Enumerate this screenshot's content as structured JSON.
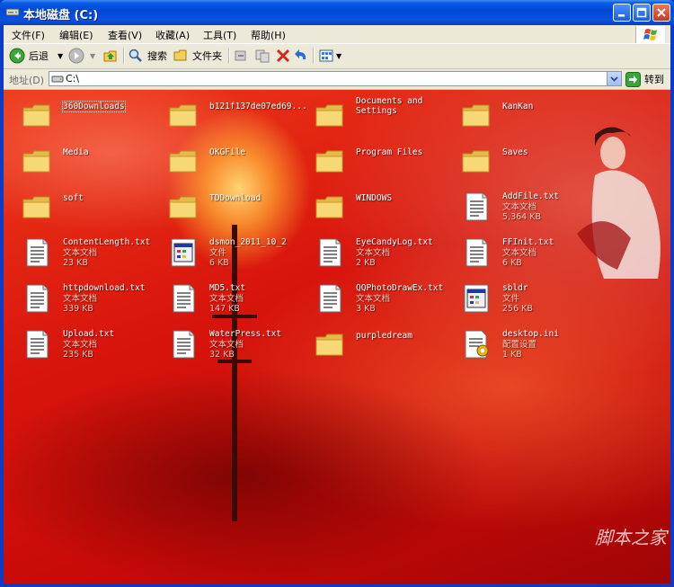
{
  "window": {
    "title": "本地磁盘 (C:)"
  },
  "menu": [
    "文件(F)",
    "编辑(E)",
    "查看(V)",
    "收藏(A)",
    "工具(T)",
    "帮助(H)"
  ],
  "toolbar": {
    "back_label": "后退",
    "search_label": "搜索",
    "folders_label": "文件夹"
  },
  "address": {
    "label": "地址(D)",
    "value": "C:\\",
    "go_label": "转到"
  },
  "watermark": "脚本之家",
  "items": [
    {
      "name": "360Downloads",
      "kind": "folder"
    },
    {
      "name": "b121f137de07ed69...",
      "kind": "folder"
    },
    {
      "name": "Documents and\nSettings",
      "kind": "folder"
    },
    {
      "name": "KanKan",
      "kind": "folder"
    },
    {
      "name": "Media",
      "kind": "folder"
    },
    {
      "name": "OKGFile",
      "kind": "folder"
    },
    {
      "name": "Program Files",
      "kind": "folder"
    },
    {
      "name": "Saves",
      "kind": "folder"
    },
    {
      "name": "soft",
      "kind": "folder"
    },
    {
      "name": "TDDownload",
      "kind": "folder"
    },
    {
      "name": "WINDOWS",
      "kind": "folder"
    },
    {
      "name": "AddFile.txt",
      "kind": "text",
      "type": "文本文档",
      "size": "5,364 KB"
    },
    {
      "name": "ContentLength.txt",
      "kind": "text",
      "type": "文本文档",
      "size": "23 KB"
    },
    {
      "name": "dsmon_2011_10_2",
      "kind": "app",
      "type": "文件",
      "size": "6 KB"
    },
    {
      "name": "EyeCandyLog.txt",
      "kind": "text",
      "type": "文本文档",
      "size": "2 KB"
    },
    {
      "name": "FFInit.txt",
      "kind": "text",
      "type": "文本文档",
      "size": "6 KB"
    },
    {
      "name": "httpdownload.txt",
      "kind": "text",
      "type": "文本文档",
      "size": "339 KB"
    },
    {
      "name": "MD5.txt",
      "kind": "text",
      "type": "文本文档",
      "size": "147 KB"
    },
    {
      "name": "QQPhotoDrawEx.txt",
      "kind": "text",
      "type": "文本文档",
      "size": "3 KB"
    },
    {
      "name": "sbldr",
      "kind": "app",
      "type": "文件",
      "size": "256 KB"
    },
    {
      "name": "Upload.txt",
      "kind": "text",
      "type": "文本文档",
      "size": "235 KB"
    },
    {
      "name": "WaterPress.txt",
      "kind": "text",
      "type": "文本文档",
      "size": "32 KB"
    },
    {
      "name": "purpledream",
      "kind": "folder"
    },
    {
      "name": "desktop.ini",
      "kind": "ini",
      "type": "配置设置",
      "size": "1 KB"
    }
  ]
}
